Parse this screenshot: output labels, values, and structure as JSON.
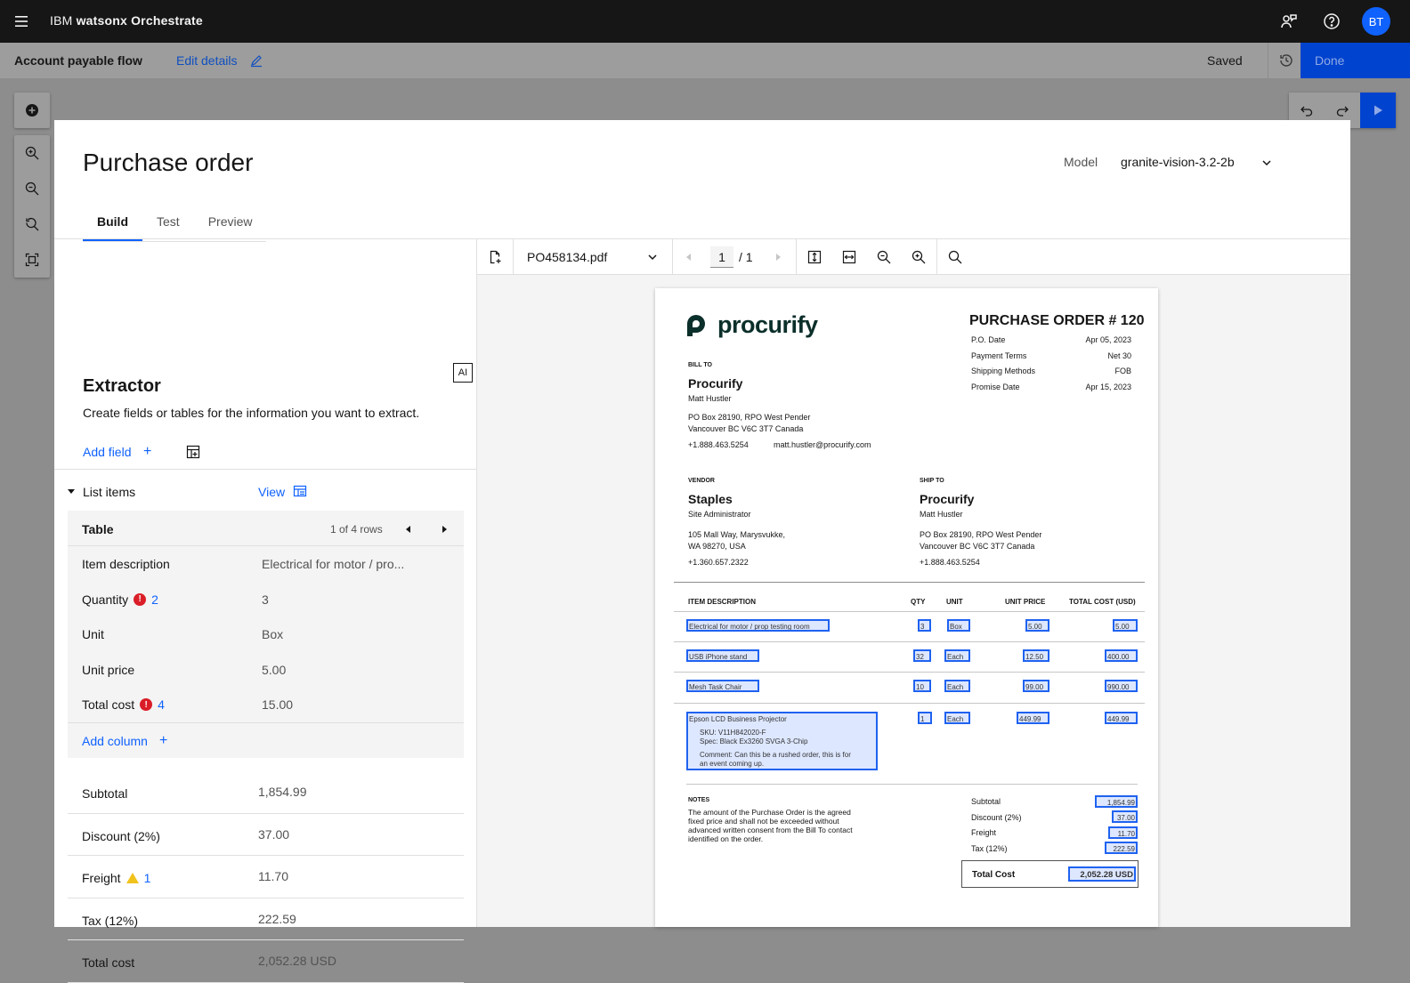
{
  "topbar": {
    "brand_prefix": "IBM ",
    "brand_name": "watsonx Orchestrate",
    "avatar_initials": "BT"
  },
  "subbar": {
    "flow_name": "Account payable flow",
    "edit_details": "Edit details",
    "status": "Saved",
    "done": "Done"
  },
  "modal": {
    "title": "Purchase order",
    "model_label": "Model",
    "model_value": "granite-vision-3.2-2b",
    "tabs": [
      "Build",
      "Test",
      "Preview"
    ]
  },
  "extractor": {
    "ai_badge": "AI",
    "title": "Extractor",
    "description": "Create fields or tables for the information you want to extract.",
    "add_field": "Add field",
    "list_label": "List items",
    "view_label": "View",
    "table": {
      "name": "Table",
      "row_status": "1 of 4 rows",
      "fields": [
        {
          "label": "Item description",
          "value": "Electrical for motor / pro...",
          "error_count": null
        },
        {
          "label": "Quantity",
          "value": "3",
          "error_count": "2"
        },
        {
          "label": "Unit",
          "value": "Box",
          "error_count": null
        },
        {
          "label": "Unit price",
          "value": "5.00",
          "error_count": null
        },
        {
          "label": "Total cost",
          "value": "15.00",
          "error_count": "4"
        }
      ],
      "add_column": "Add column"
    },
    "summary": [
      {
        "label": "Subtotal",
        "value": "1,854.99",
        "warn_count": null
      },
      {
        "label": "Discount (2%)",
        "value": "37.00",
        "warn_count": null
      },
      {
        "label": "Freight",
        "value": "11.70",
        "warn_count": "1"
      },
      {
        "label": "Tax (12%)",
        "value": "222.59",
        "warn_count": null
      },
      {
        "label": "Total cost",
        "value": "2,052.28 USD",
        "warn_count": null
      }
    ]
  },
  "viewer": {
    "file_name": "PO458134.pdf",
    "page_current": "1",
    "page_total": "/ 1"
  },
  "document": {
    "logo": "procurify",
    "po_title": "PURCHASE ORDER # 120",
    "meta": [
      {
        "k": "P.O. Date",
        "v": "Apr 05, 2023"
      },
      {
        "k": "Payment Terms",
        "v": "Net 30"
      },
      {
        "k": "Shipping Methods",
        "v": "FOB"
      },
      {
        "k": "Promise Date",
        "v": "Apr 15, 2023"
      }
    ],
    "bill_to": {
      "label": "BILL TO",
      "name": "Procurify",
      "contact": "Matt Hustler",
      "addr1": "PO Box 28190, RPO West Pender",
      "addr2": "Vancouver BC V6C 3T7 Canada",
      "phone": "+1.888.463.5254",
      "email": "matt.hustler@procurify.com"
    },
    "vendor": {
      "label": "VENDOR",
      "name": "Staples",
      "contact": "Site Administrator",
      "addr1": "105 Mall Way, Marysvukke,",
      "addr2": "WA 98270, USA",
      "phone": "+1.360.657.2322"
    },
    "ship_to": {
      "label": "SHIP TO",
      "name": "Procurify",
      "contact": "Matt Hustler",
      "addr1": "PO Box 28190, RPO West Pender",
      "addr2": "Vancouver BC V6C 3T7 Canada",
      "phone": "+1.888.463.5254"
    },
    "columns": [
      "ITEM DESCRIPTION",
      "QTY",
      "UNIT",
      "UNIT PRICE",
      "TOTAL COST (USD)"
    ],
    "rows": [
      {
        "desc": "Electrical for motor / prop testing room",
        "qty": "3",
        "unit": "Box",
        "price": "5.00",
        "total": "5.00"
      },
      {
        "desc": "USB iPhone stand",
        "qty": "32",
        "unit": "Each",
        "price": "12.50",
        "total": "400.00"
      },
      {
        "desc": "Mesh Task Chair",
        "qty": "10",
        "unit": "Each",
        "price": "99.00",
        "total": "990.00"
      },
      {
        "desc": "Epson LCD Business Projector",
        "qty": "1",
        "unit": "Each",
        "price": "449.99",
        "total": "449.99"
      }
    ],
    "row4_sku": "SKU: V11H842020-F",
    "row4_spec": "Spec: Black Ex3260 SVGA 3-Chip",
    "row4_comment1": "Comment: Can this be a rushed order, this is for",
    "row4_comment2": "an event coming up.",
    "notes_label": "NOTES",
    "notes_text1": "The amount of the Purchase Order is the agreed",
    "notes_text2": "fixed price and shall not be exceeded without",
    "notes_text3": "advanced written consent from the Bill To contact",
    "notes_text4": "identified on the order.",
    "totals": [
      {
        "k": "Subtotal",
        "v": "1,854.99"
      },
      {
        "k": "Discount (2%)",
        "v": "37.00"
      },
      {
        "k": "Freight",
        "v": "11.70"
      },
      {
        "k": "Tax (12%)",
        "v": "222.59"
      }
    ],
    "total_cost_label": "Total Cost",
    "total_cost_value": "2,052.28 USD"
  },
  "colors": {
    "accent": "#0f62fe",
    "error": "#da1e28",
    "warning": "#f1c21b",
    "header": "#161616"
  }
}
